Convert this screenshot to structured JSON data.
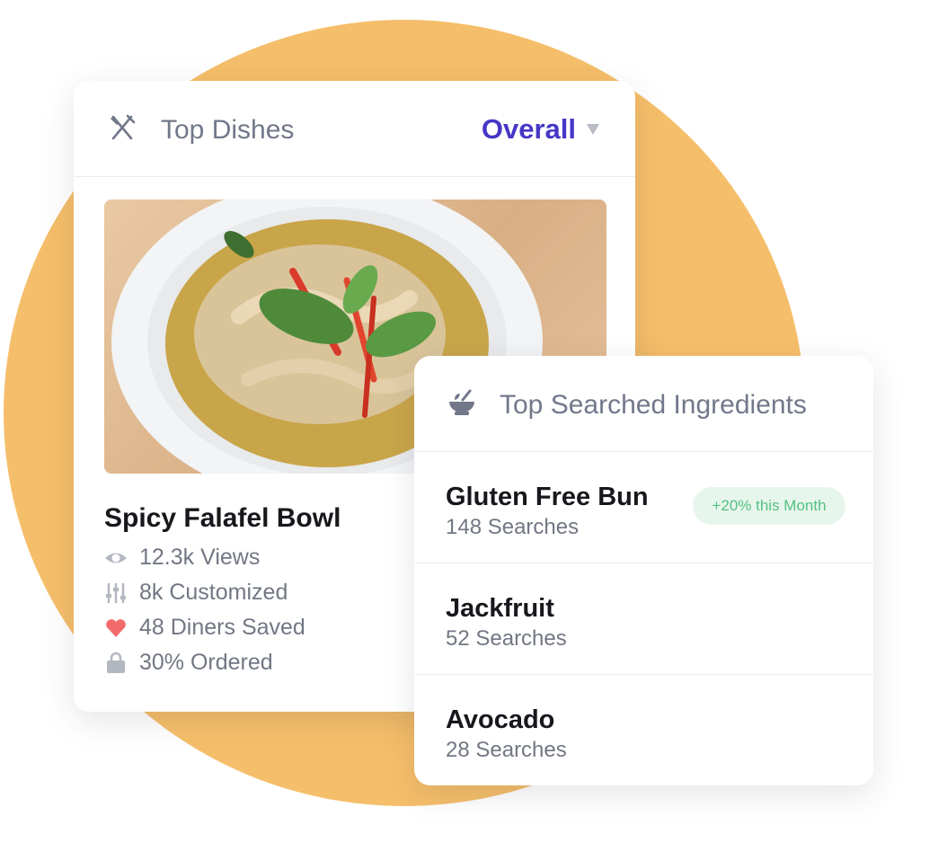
{
  "top_dishes": {
    "title": "Top Dishes",
    "filter_label": "Overall",
    "dish": {
      "name": "Spicy Falafel Bowl",
      "stats": [
        {
          "icon": "eye-icon",
          "text": "12.3k Views"
        },
        {
          "icon": "sliders-icon",
          "text": "8k Customized"
        },
        {
          "icon": "heart-icon",
          "text": "48 Diners Saved"
        },
        {
          "icon": "shopping-bag-icon",
          "text": "30% Ordered"
        }
      ]
    }
  },
  "top_ingredients": {
    "title": "Top Searched Ingredients",
    "items": [
      {
        "name": "Gluten Free Bun",
        "count": "148 Searches",
        "badge": "+20% this Month"
      },
      {
        "name": "Jackfruit",
        "count": "52 Searches"
      },
      {
        "name": "Avocado",
        "count": "28 Searches"
      }
    ]
  },
  "colors": {
    "background_circle": "#F5BE6A",
    "accent": "#4637C6",
    "heart": "#F26B6B",
    "badge_text": "#55C083",
    "badge_bg": "#E7F6EC"
  }
}
